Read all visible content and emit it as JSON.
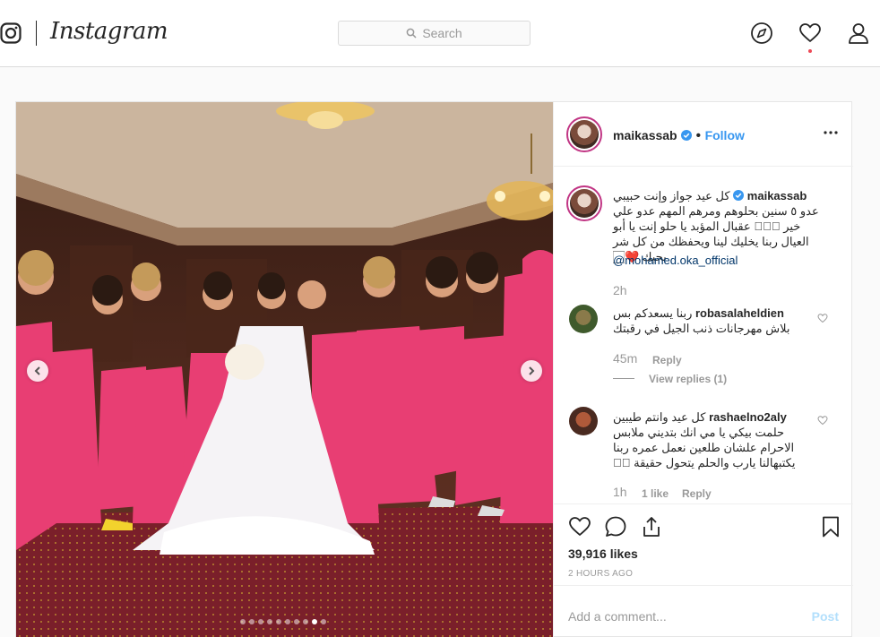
{
  "nav": {
    "logo_text": "Instagram",
    "search_placeholder": "Search",
    "icons": [
      "instagram-glyph-icon",
      "compass-icon",
      "heart-icon",
      "profile-icon"
    ],
    "notification_color": "#ed4956"
  },
  "post": {
    "author": "maikassab",
    "follow_label": "Follow",
    "verified_color": "#3897f0",
    "carousel_index": 8,
    "carousel_total": 10,
    "caption": {
      "user": "maikassab",
      "text": "كل عيد جواز وإنت حبيبي عدو ٥ سنين بحلوهم ومرهم المهم عدو علي خير 🏻🏻🏻 عقبال المؤبد يا حلو إنت يا أبو العيال ربنا يخليك لينا ويحفظك من كل شر بحبك ❤️🏻",
      "mention": "@mohamed.oka_official",
      "time": "2h"
    },
    "comments": [
      {
        "user": "robasalaheldien",
        "text": "ربنا يسعدكم بس بلاش مهرجانات ذنب الجيل في رقبتك",
        "time": "45m",
        "reply_label": "Reply",
        "view_replies": "View replies (1)"
      },
      {
        "user": "rashaelno2aly",
        "text": "كل عيد وانتم طيبين حلمت بيكي يا مي انك بتديني ملابس الاحرام علشان طلعين نعمل عمره ربنا يكتبهالنا يارب والحلم يتحول حقيقة 🏻🏻",
        "time": "1h",
        "likes_label": "1 like",
        "reply_label": "Reply"
      }
    ],
    "likes": "39,916 likes",
    "time_ago": "2 HOURS AGO",
    "add_comment_placeholder": "Add a comment...",
    "post_label": "Post",
    "accent_color": "#3897f0"
  }
}
